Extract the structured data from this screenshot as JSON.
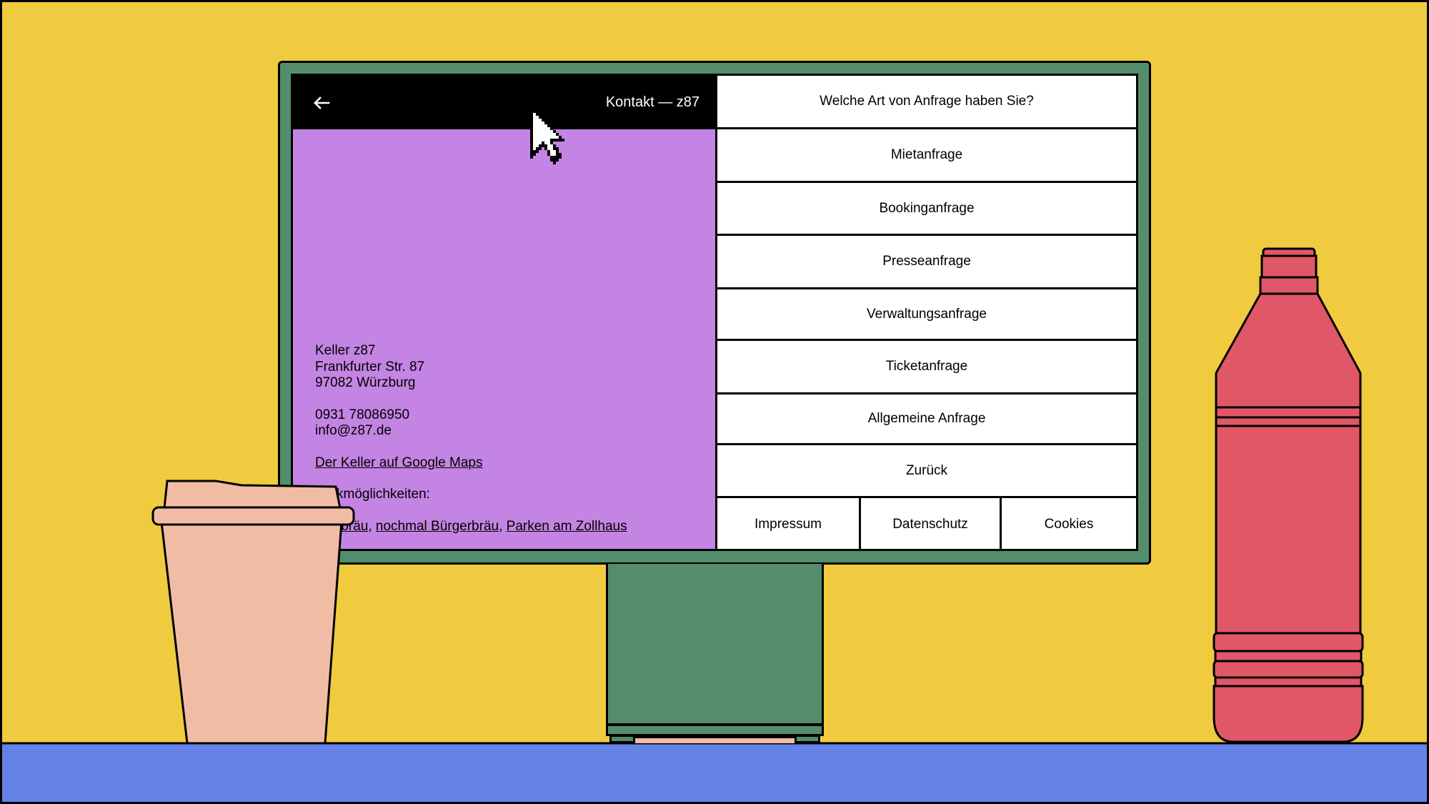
{
  "colors": {
    "background": "#f0cb40",
    "floor": "#6582e6",
    "monitor": "#548d6b",
    "panel": "#c484e3",
    "cup": "#f0bda4",
    "bottle": "#e05867"
  },
  "header": {
    "back_icon": "arrow-left-icon",
    "title": "Kontakt — z87"
  },
  "contact": {
    "name": "Keller z87",
    "street": "Frankfurter Str. 87",
    "city": "97082 Würzburg",
    "phone": "0931 78086950",
    "email": "info@z87.de",
    "maps_link": "Der Keller auf Google Maps",
    "parking_label": "kmöglichkeiten:",
    "parking_links": [
      "rbräu",
      "nochmal Bürgerbräu",
      "Parken am Zollhaus"
    ]
  },
  "inquiry": {
    "question": "Welche Art von Anfrage haben Sie?",
    "options": [
      "Mietanfrage",
      "Bookinganfrage",
      "Presseanfrage",
      "Verwaltungsanfrage",
      "Ticketanfrage",
      "Allgemeine Anfrage",
      "Zurück"
    ]
  },
  "footer": {
    "links": [
      "Impressum",
      "Datenschutz",
      "Cookies"
    ]
  }
}
